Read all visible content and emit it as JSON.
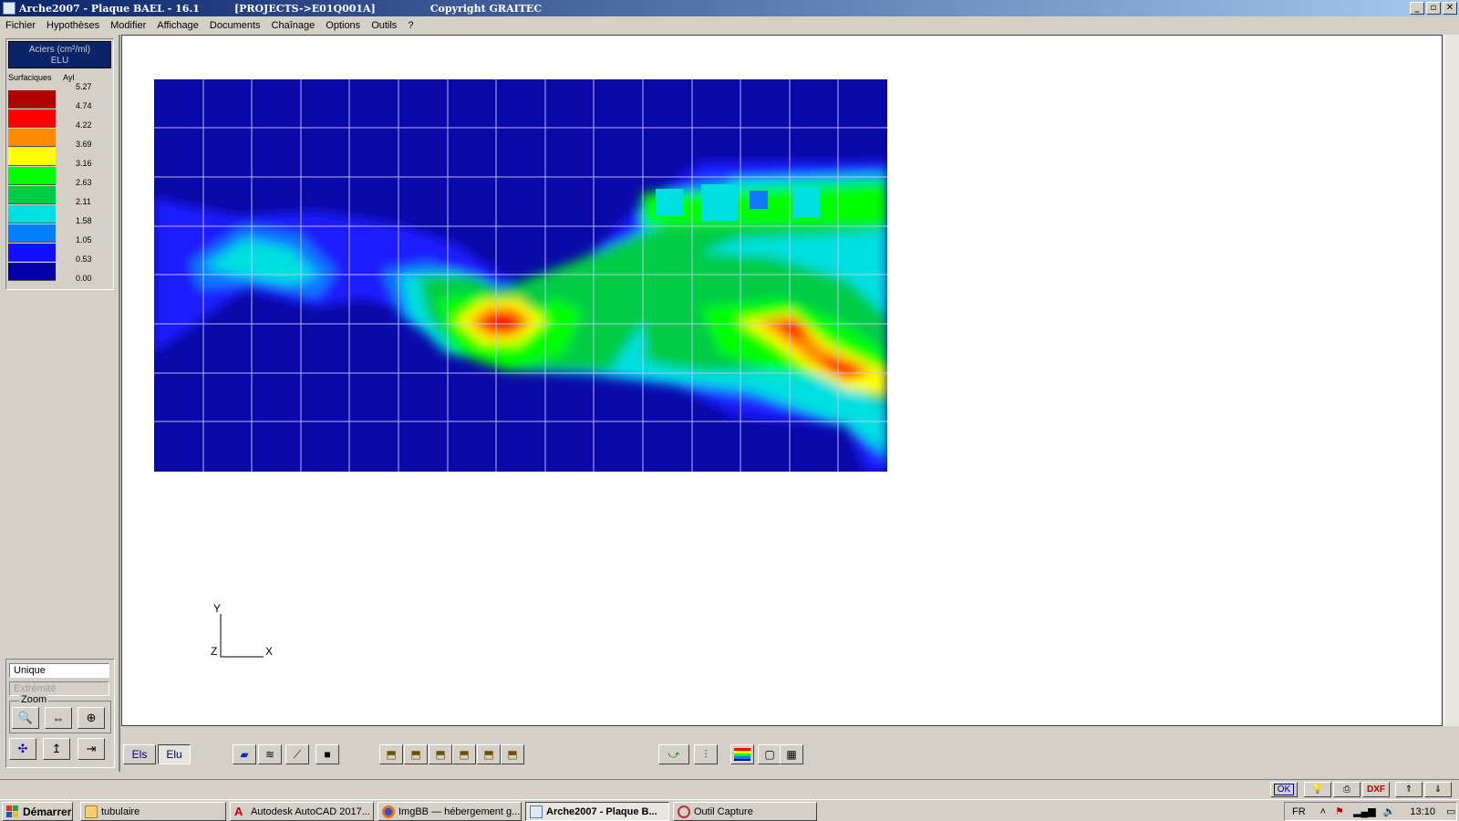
{
  "window": {
    "title": "Arche2007 - Plaque BAEL - 16.1",
    "project": "[PROJECTS->E01Q001A]",
    "copyright": "Copyright GRAITEC",
    "controls": {
      "minimize": "_",
      "restore": "▫",
      "close": "✕"
    }
  },
  "menu": [
    "Fichier",
    "Hypothèses",
    "Modifier",
    "Affichage",
    "Documents",
    "Chaînage",
    "Options",
    "Outils",
    "?"
  ],
  "legend": {
    "title_line1": "Aciers (cm²/ml)",
    "title_line2": "ELU",
    "col1": "Surfaciques",
    "col2": "Ayl",
    "values": [
      "5.27",
      "4.74",
      "4.22",
      "3.69",
      "3.16",
      "2.63",
      "2.11",
      "1.58",
      "1.05",
      "0.53",
      "0.00"
    ],
    "colors": [
      "#b00000",
      "#ff0000",
      "#ff8c00",
      "#ffff00",
      "#00ff00",
      "#00cc44",
      "#00e0e0",
      "#0080ff",
      "#1010ff",
      "#0000a8"
    ]
  },
  "controls": {
    "mode_value": "Unique",
    "extremite_value": "Extrémité",
    "zoom_label": "Zoom"
  },
  "axes": {
    "y": "Y",
    "z": "Z",
    "x": "X"
  },
  "bottom_toolbar": {
    "els": "Els",
    "elu": "Elu"
  },
  "statusbar": {
    "ok": "OK",
    "dxf": "DXF"
  },
  "taskbar": {
    "start": "Démarrer",
    "tasks": [
      "tubulaire",
      "Autodesk AutoCAD 2017...",
      "ImgBB — hébergement g...",
      "Arche2007 - Plaque B...",
      "Outil Capture"
    ],
    "lang": "FR",
    "clock": "13:10"
  }
}
